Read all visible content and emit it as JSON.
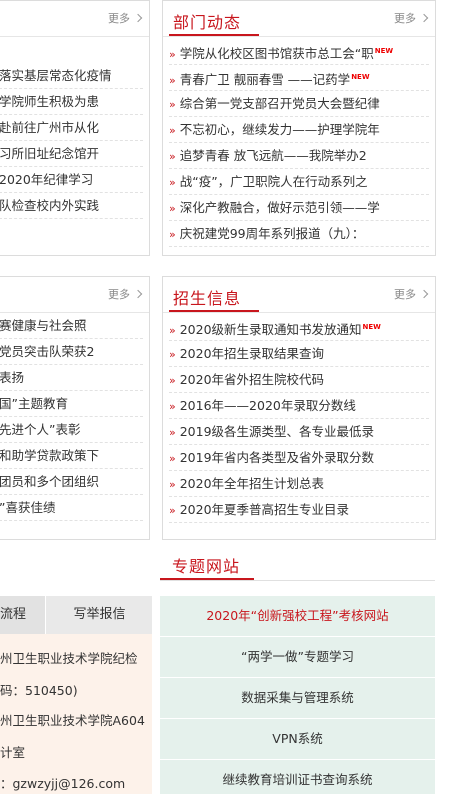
{
  "more_label": "更多",
  "left_top": {
    "items": [
      "落实基层常态化疫情",
      "学院师生积极为患",
      "赴前往广州市从化",
      "习所旧址纪念馆开",
      "2020年纪律学习",
      "队检查校内外实践"
    ]
  },
  "dept_news": {
    "title": "部门动态",
    "items": [
      {
        "text": "学院从化校区图书馆获市总工会“职",
        "new": true
      },
      {
        "text": "青春广卫 靓丽春雪 ——记药学",
        "new": true
      },
      {
        "text": "综合第一党支部召开党员大会暨纪律",
        "new": false
      },
      {
        "text": "不忘初心，继续发力——护理学院年",
        "new": false
      },
      {
        "text": "追梦青春 放飞远航——我院举办2",
        "new": false
      },
      {
        "text": "战“疫”，广卫职院人在行动系列之",
        "new": false
      },
      {
        "text": "深化产教融合，做好示范引领——学",
        "new": false
      },
      {
        "text": "庆祝建党99周年系列报道（九）：",
        "new": false
      }
    ]
  },
  "left_mid": {
    "items": [
      "赛健康与社会照",
      "党员突击队荣获2",
      "表扬",
      "国”主题教育",
      "先进个人”表彰",
      "和助学贷款政策下",
      "团员和多个团组织",
      "”喜获佳绩"
    ]
  },
  "admissions": {
    "title": "招生信息",
    "items": [
      {
        "text": "2020级新生录取通知书发放通知",
        "new": true
      },
      {
        "text": "2020年招生录取结果查询",
        "new": false
      },
      {
        "text": "2020年省外招生院校代码",
        "new": false
      },
      {
        "text": "2016年——2020年录取分数线",
        "new": false
      },
      {
        "text": "2019级各生源类型、各专业最低录",
        "new": false
      },
      {
        "text": "2019年省内各类型及省外录取分数",
        "new": false
      },
      {
        "text": "2020年全年招生计划总表",
        "new": false
      },
      {
        "text": "2020年夏季普高招生专业目录",
        "new": false
      }
    ]
  },
  "report": {
    "tab_process": "流程",
    "tab_report": "写举报信",
    "lines": [
      "州卫生职业技术学院纪检",
      "码：510450)",
      "州卫生职业技术学院A604",
      "计室",
      "：gzwzyjj@126.com"
    ]
  },
  "special_sites": {
    "title": "专题网站",
    "items": [
      "2020年“创新强校工程”考核网站",
      "“两学一做”专题学习",
      "数据采集与管理系统",
      "VPN系统",
      "继续教育培训证书查询系统"
    ]
  }
}
